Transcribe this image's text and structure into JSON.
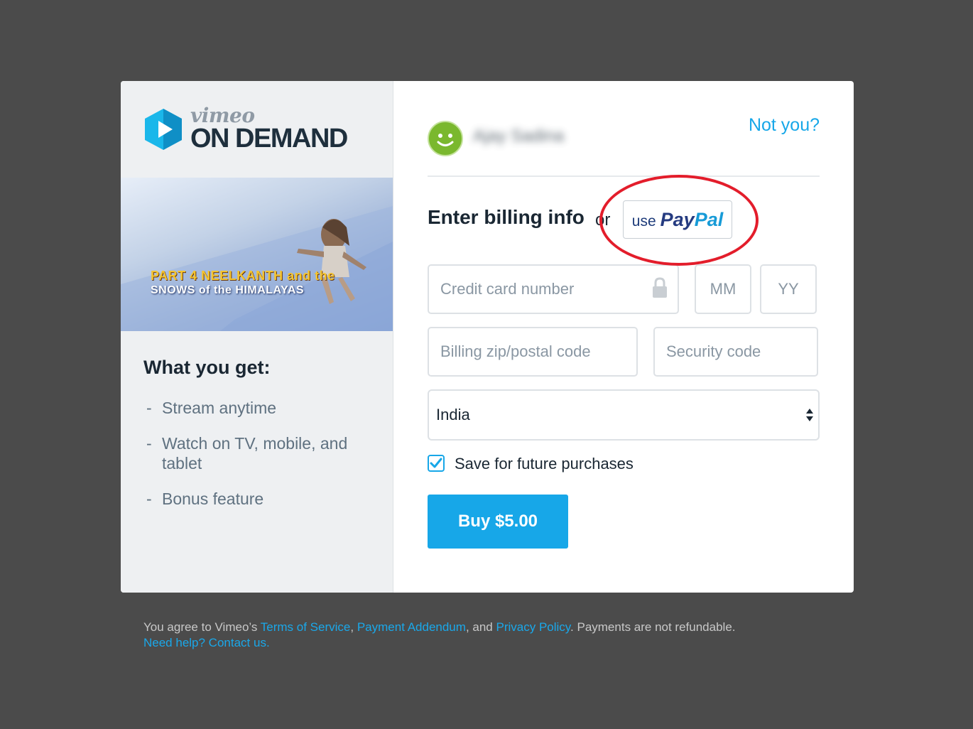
{
  "brand": {
    "logo_top": "vimeo",
    "logo_bottom": "ON DEMAND"
  },
  "poster": {
    "title_line1": "PART 4 NEELKANTH and the",
    "title_line2": "SNOWS of the HIMALAYAS"
  },
  "sidebar": {
    "heading": "What you get:",
    "items": [
      {
        "label": "Stream anytime"
      },
      {
        "label": "Watch on TV, mobile, and tablet"
      },
      {
        "label": "Bonus feature"
      }
    ]
  },
  "user": {
    "name": "Ajay Sadina",
    "not_you": "Not you?"
  },
  "billing": {
    "heading": "Enter billing info",
    "or": "or",
    "paypal_use": "use",
    "paypal_pay": "Pay",
    "paypal_pal": "Pal",
    "cc_placeholder": "Credit card number",
    "mm_placeholder": "MM",
    "yy_placeholder": "YY",
    "zip_placeholder": "Billing zip/postal code",
    "security_placeholder": "Security code",
    "country": "India",
    "save_label": "Save for future purchases",
    "save_checked": true,
    "buy_label": "Buy $5.00"
  },
  "footer": {
    "prefix": "You agree to Vimeo’s ",
    "terms": "Terms of Service",
    "comma1": ", ",
    "addendum": "Payment Addendum",
    "and": ", and ",
    "privacy": "Privacy Policy",
    "suffix": ". Payments are not refundable.",
    "help": "Need help? Contact us."
  },
  "colors": {
    "accent": "#17a7e8",
    "highlight_ring": "#e31d2b",
    "backdrop": "#4b4b4b"
  }
}
